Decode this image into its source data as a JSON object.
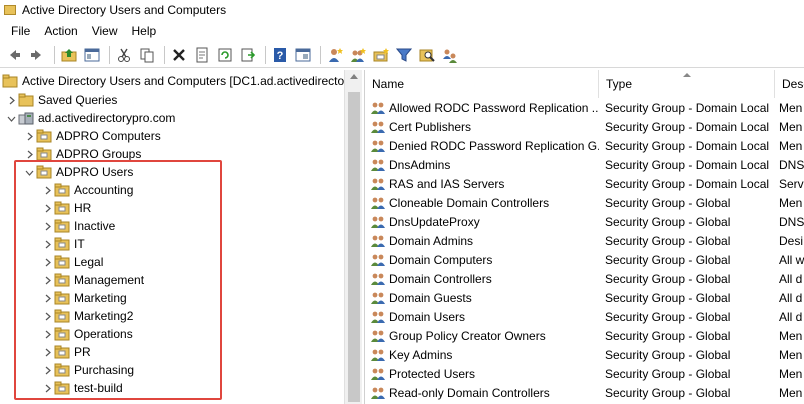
{
  "window": {
    "title": "Active Directory Users and Computers"
  },
  "menu": [
    "File",
    "Action",
    "View",
    "Help"
  ],
  "toolbar": [
    "back-icon",
    "forward-icon",
    "up-folder-icon",
    "show-tree-icon",
    "cut-icon",
    "copy-icon",
    "delete-icon",
    "properties-icon",
    "refresh-icon",
    "export-icon",
    "help-icon",
    "console-icon",
    "new-user-icon",
    "new-group-icon",
    "new-ou-icon",
    "filter-icon",
    "find-icon",
    "add-to-group-icon"
  ],
  "tree": {
    "root": "Active Directory Users and Computers [DC1.ad.activedirector",
    "saved_queries": "Saved Queries",
    "domain": "ad.activedirectorypro.com",
    "ou_computers": "ADPRO Computers",
    "ou_groups": "ADPRO Groups",
    "ou_users": "ADPRO Users",
    "children": [
      "Accounting",
      "HR",
      "Inactive",
      "IT",
      "Legal",
      "Management",
      "Marketing",
      "Marketing2",
      "Operations",
      "PR",
      "Purchasing",
      "test-build"
    ]
  },
  "list": {
    "columns": [
      "Name",
      "Type",
      "Desc"
    ],
    "rows": [
      {
        "name": "Allowed RODC Password Replication ...",
        "type": "Security Group - Domain Local",
        "desc": "Men"
      },
      {
        "name": "Cert Publishers",
        "type": "Security Group - Domain Local",
        "desc": "Men"
      },
      {
        "name": "Denied RODC Password Replication G...",
        "type": "Security Group - Domain Local",
        "desc": "Men"
      },
      {
        "name": "DnsAdmins",
        "type": "Security Group - Domain Local",
        "desc": "DNS"
      },
      {
        "name": "RAS and IAS Servers",
        "type": "Security Group - Domain Local",
        "desc": "Serv"
      },
      {
        "name": "Cloneable Domain Controllers",
        "type": "Security Group - Global",
        "desc": "Men"
      },
      {
        "name": "DnsUpdateProxy",
        "type": "Security Group - Global",
        "desc": "DNS"
      },
      {
        "name": "Domain Admins",
        "type": "Security Group - Global",
        "desc": "Desi"
      },
      {
        "name": "Domain Computers",
        "type": "Security Group - Global",
        "desc": "All w"
      },
      {
        "name": "Domain Controllers",
        "type": "Security Group - Global",
        "desc": "All d"
      },
      {
        "name": "Domain Guests",
        "type": "Security Group - Global",
        "desc": "All d"
      },
      {
        "name": "Domain Users",
        "type": "Security Group - Global",
        "desc": "All d"
      },
      {
        "name": "Group Policy Creator Owners",
        "type": "Security Group - Global",
        "desc": "Men"
      },
      {
        "name": "Key Admins",
        "type": "Security Group - Global",
        "desc": "Men"
      },
      {
        "name": "Protected Users",
        "type": "Security Group - Global",
        "desc": "Men"
      },
      {
        "name": "Read-only Domain Controllers",
        "type": "Security Group - Global",
        "desc": "Men"
      }
    ]
  },
  "colors": {
    "highlight_border": "#e0463e",
    "folder": "#e8c25a"
  }
}
